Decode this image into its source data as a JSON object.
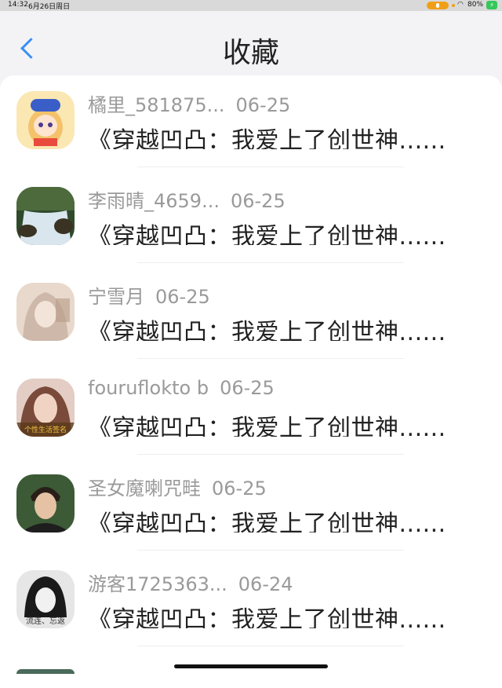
{
  "status_bar": {
    "time": "14:32",
    "date": "6月26日周日",
    "battery": "80%",
    "wifi_icon": "wifi-icon",
    "mic_icon": "microphone-icon",
    "charging_icon": "bolt-icon"
  },
  "header": {
    "title": "收藏",
    "back_icon": "chevron-left-icon",
    "accent_color": "#3a8ef6"
  },
  "favorites": [
    {
      "user": "橘里_581875...",
      "date": "06-25",
      "message": "《穿越凹凸：我爱上了创世神......",
      "avatar": "anime-girl-avatar",
      "avatar_color": "#f3c26a"
    },
    {
      "user": "李雨晴_4659...",
      "date": "06-25",
      "message": "《穿越凹凸：我爱上了创世神......",
      "avatar": "waterfall-avatar",
      "avatar_color": "#3f5a37"
    },
    {
      "user": "宁雪月",
      "date": "06-25",
      "message": "《穿越凹凸：我爱上了创世神......",
      "avatar": "pale-girl-avatar",
      "avatar_color": "#d8c4b8"
    },
    {
      "user": "fouruflokto b",
      "date": "06-25",
      "message": "《穿越凹凸：我爱上了创世神......",
      "avatar": "portrait-avatar",
      "avatar_color": "#b07a6a",
      "avatar_text": "个性生活签名"
    },
    {
      "user": "圣女魔喇咒畦",
      "date": "06-25",
      "message": "《穿越凹凸：我爱上了创世神......",
      "avatar": "boy-portrait-avatar",
      "avatar_color": "#3c5a36"
    },
    {
      "user": "游客1725363...",
      "date": "06-24",
      "message": "《穿越凹凸：我爱上了创世神......",
      "avatar": "bw-girl-avatar",
      "avatar_color": "#cfcfcf",
      "avatar_text": "流连、忘返"
    }
  ],
  "partial_next_user": "...（部分可见）"
}
